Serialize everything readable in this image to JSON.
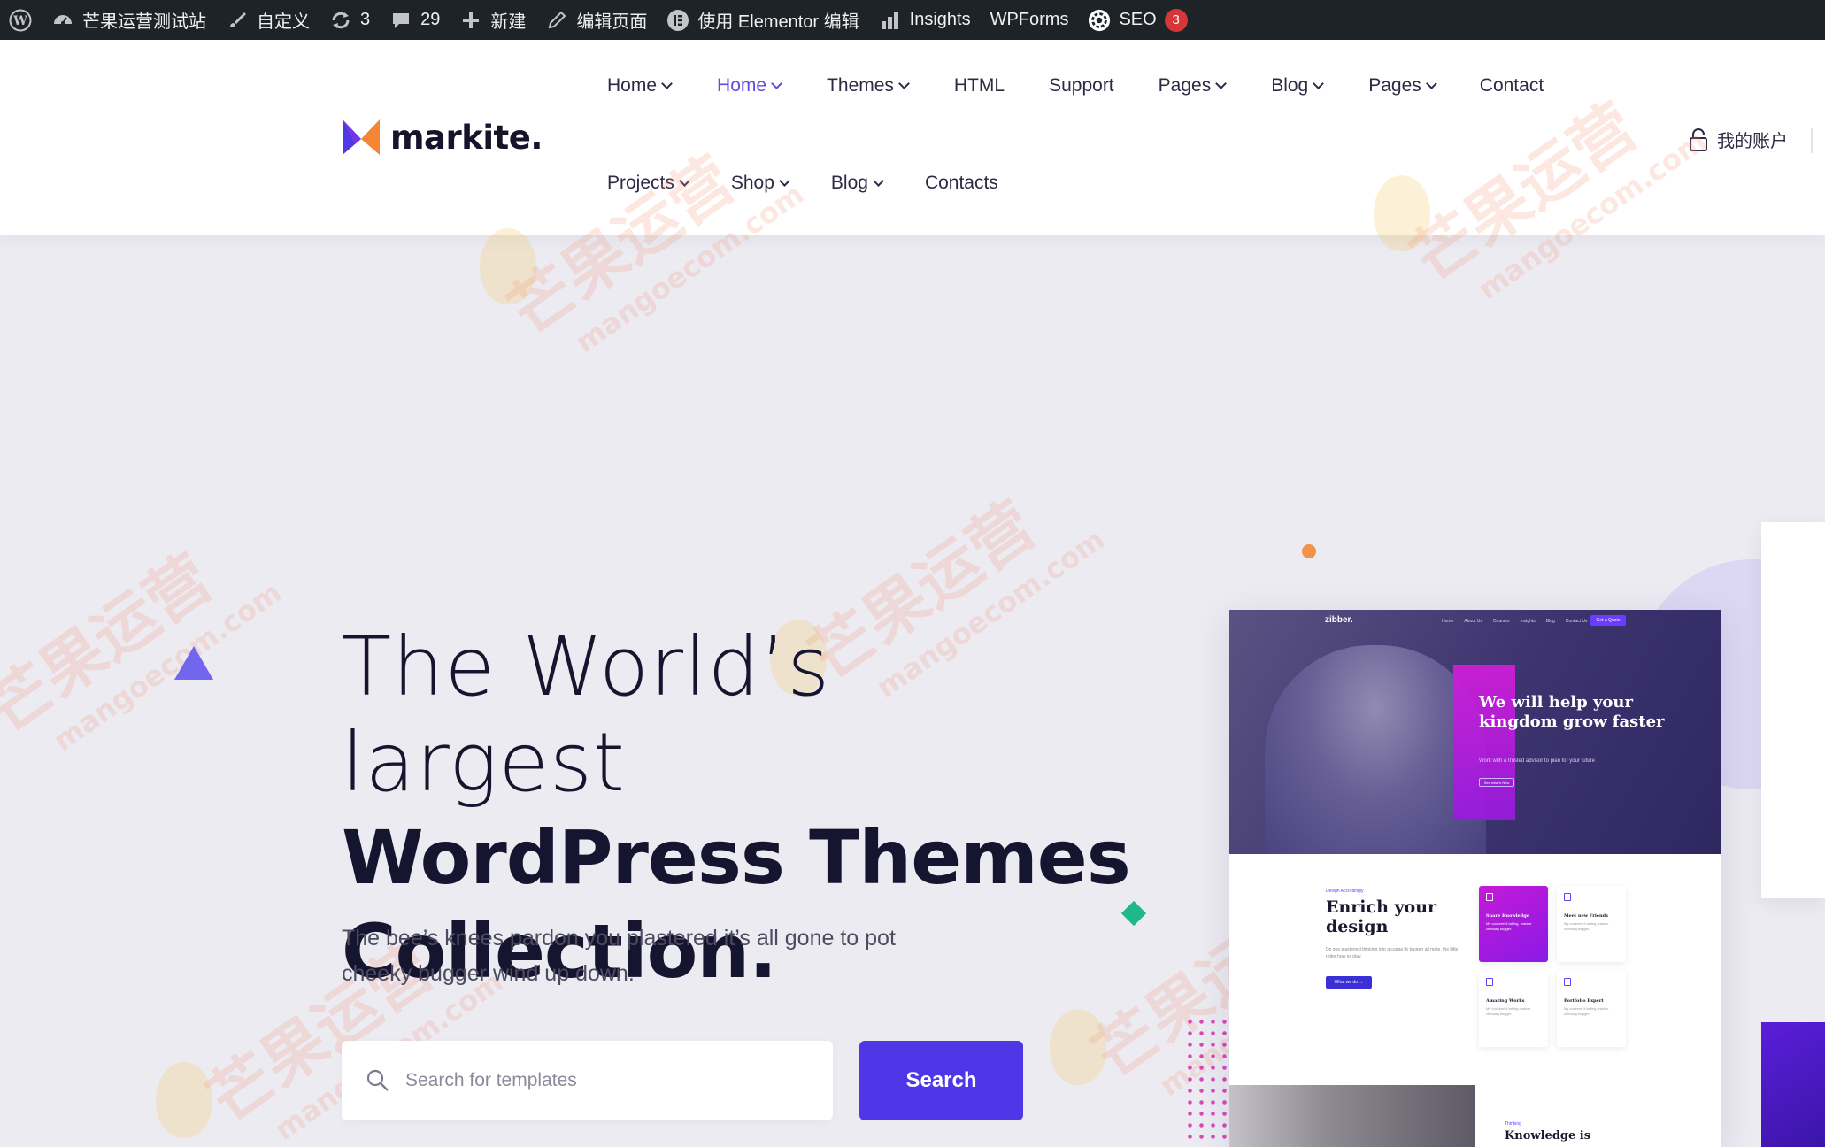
{
  "admin_bar": {
    "site_name": "芒果运营测试站",
    "customize": "自定义",
    "updates_count": "3",
    "comments_count": "29",
    "new": "新建",
    "edit_page": "编辑页面",
    "elementor": "使用 Elementor 编辑",
    "insights": "Insights",
    "wpforms": "WPForms",
    "seo": "SEO",
    "seo_badge": "3"
  },
  "header": {
    "logo_text": "markite.",
    "nav_row1": [
      {
        "label": "Home",
        "has_dropdown": true,
        "active": false
      },
      {
        "label": "Home",
        "has_dropdown": true,
        "active": true
      },
      {
        "label": "Themes",
        "has_dropdown": true,
        "active": false
      },
      {
        "label": "HTML",
        "has_dropdown": false,
        "active": false
      },
      {
        "label": "Support",
        "has_dropdown": false,
        "active": false
      },
      {
        "label": "Pages",
        "has_dropdown": true,
        "active": false
      },
      {
        "label": "Blog",
        "has_dropdown": true,
        "active": false
      },
      {
        "label": "Pages",
        "has_dropdown": true,
        "active": false
      },
      {
        "label": "Contact",
        "has_dropdown": false,
        "active": false
      }
    ],
    "nav_row2": [
      {
        "label": "Projects",
        "has_dropdown": true
      },
      {
        "label": "Shop",
        "has_dropdown": true
      },
      {
        "label": "Blog",
        "has_dropdown": true
      },
      {
        "label": "Contacts",
        "has_dropdown": false
      }
    ],
    "account_label": "我的账户"
  },
  "hero": {
    "title_line1": "The World’s largest",
    "title_line2": "WordPress Themes",
    "title_line3": "Collection.",
    "subtitle_line1": "The bee’s knees pardon you plastered it’s all gone to pot",
    "subtitle_line2": "cheeky bugger wind up down.",
    "search_placeholder": "Search for templates",
    "search_button": "Search"
  },
  "preview": {
    "brand": "zibber.",
    "nav": [
      "Home",
      "About Us",
      "Courses",
      "Insights",
      "Blog",
      "Contact Us"
    ],
    "cta": "Get a Quote",
    "headline": "We will help your kingdom grow faster",
    "hero_small": "Work with a trusted advisor to plan for your future",
    "hero_button": "See what's New",
    "eyebrow": "Design Accordingly",
    "section_title": "Enrich your design",
    "section_text": "Do one plasterred thinking into a cuppa fly bugger all mate, the little rotter how ex play.",
    "section_button": "What we do →",
    "tiles": [
      {
        "title": "Share Knowledge",
        "desc": "My cockerel it taffing, cracker chinwag bugger."
      },
      {
        "title": "Meet new Friends",
        "desc": "My cockerel it taffing cracker chinwag bugger."
      },
      {
        "title": "Amazing Works",
        "desc": "My cockerel it taffing cracker chinwag bugger."
      },
      {
        "title": "Portfolio Expert",
        "desc": "My cockerel it taffing cracker chinwag bugger."
      }
    ],
    "bottom_eyebrow": "Thinking",
    "bottom_title": "Knowledge is"
  },
  "colors": {
    "accent": "#4f36e6",
    "nav_active": "#5f4de3",
    "page_bg": "#ecebf2",
    "admin_bar_bg": "#1d2327",
    "seo_badge": "#d63638"
  },
  "watermark": {
    "text": "芒果运营",
    "domain": "mangoecom.com"
  }
}
